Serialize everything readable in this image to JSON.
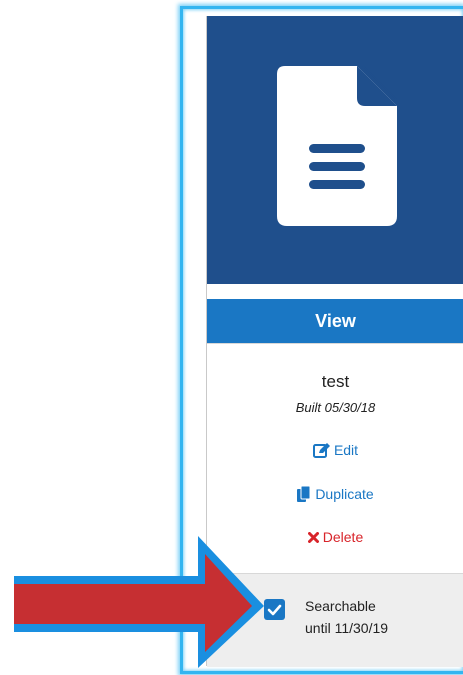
{
  "card": {
    "view_label": "View",
    "title": "test",
    "built": "Built 05/30/18",
    "edit_label": "Edit",
    "duplicate_label": "Duplicate",
    "delete_label": "Delete",
    "searchable_label": "Searchable",
    "searchable_until": "until 11/30/19",
    "searchable_checked": true
  },
  "icons": {
    "thumbnail": "document-icon",
    "edit": "edit-icon",
    "duplicate": "duplicate-icon",
    "delete": "delete-x-icon",
    "checkbox": "checkmark-icon",
    "callout": "red-arrow-icon"
  },
  "colors": {
    "thumbnail_bg": "#1f4f8c",
    "view_bar": "#1a77c4",
    "action_link": "#1a77c4",
    "delete": "#d8242a",
    "frame_glow": "#33b5f0",
    "arrow_fill": "#c62f32",
    "arrow_outline": "#1a8fe0"
  }
}
